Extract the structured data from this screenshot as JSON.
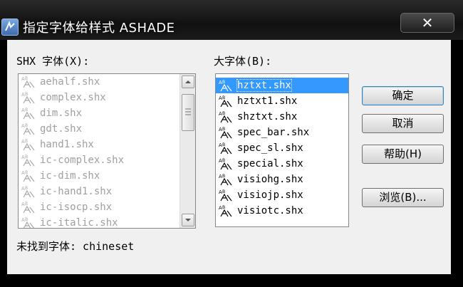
{
  "window": {
    "title": "指定字体给样式 ASHADE",
    "close_label": "✕"
  },
  "shx_list": {
    "label": "SHX 字体(X):",
    "items": [
      "aehalf.shx",
      "complex.shx",
      "dim.shx",
      "gdt.shx",
      "hand1.shx",
      "ic-complex.shx",
      "ic-dim.shx",
      "ic-hand1.shx",
      "ic-isocp.shx",
      "ic-italic.shx"
    ]
  },
  "big_list": {
    "label": "大字体(B):",
    "items": [
      "hztxt.shx",
      "hztxt1.shx",
      "shztxt.shx",
      "spec_bar.shx",
      "spec_sl.shx",
      "special.shx",
      "visiohg.shx",
      "visiojp.shx",
      "visiotc.shx"
    ],
    "selected": "hztxt.shx"
  },
  "buttons": {
    "ok": "确定",
    "cancel": "取消",
    "help": "帮助(H)",
    "browse": "浏览(B)..."
  },
  "status": {
    "text": "未找到字体: chineset"
  }
}
